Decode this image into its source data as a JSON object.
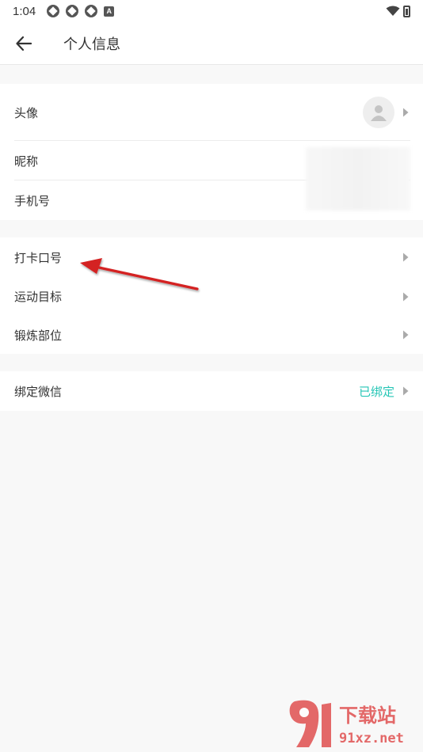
{
  "status_bar": {
    "time": "1:04",
    "badge_letter": "A"
  },
  "header": {
    "title": "个人信息"
  },
  "profile": {
    "avatar_label": "头像",
    "nickname_label": "昵称",
    "phone_label": "手机号"
  },
  "settings": {
    "items": [
      {
        "label": "打卡口号"
      },
      {
        "label": "运动目标"
      },
      {
        "label": "锻炼部位"
      }
    ]
  },
  "wechat": {
    "label": "绑定微信",
    "status": "已绑定"
  },
  "watermark": {
    "brand": "下载站",
    "domain": "91xz.net"
  },
  "colors": {
    "accent": "#26c6b6",
    "annotation_arrow": "#d42020"
  }
}
